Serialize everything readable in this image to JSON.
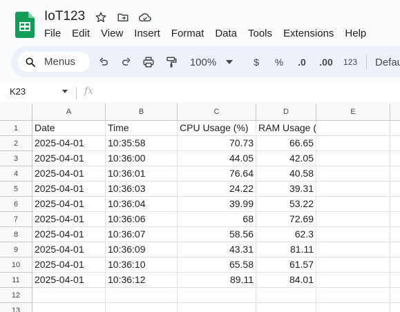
{
  "doc": {
    "title": "IoT123",
    "menus": [
      "File",
      "Edit",
      "View",
      "Insert",
      "Format",
      "Data",
      "Tools",
      "Extensions",
      "Help"
    ]
  },
  "toolbar": {
    "search_label": "Menus",
    "zoom": "100%",
    "currency": "$",
    "percent": "%",
    "dec_decrease": ".0",
    "dec_increase": ".00",
    "number_format": "123",
    "font": "Defau"
  },
  "formula_bar": {
    "cell_ref": "K23",
    "fx_label": "fx"
  },
  "sheet": {
    "columns": [
      "A",
      "B",
      "C",
      "D",
      "E"
    ],
    "row_numbers": [
      "1",
      "2",
      "3",
      "4",
      "5",
      "6",
      "7",
      "8",
      "9",
      "10",
      "11",
      "12",
      "13"
    ],
    "header_row": [
      "Date",
      "Time",
      "CPU Usage (%)",
      "RAM Usage (%)"
    ],
    "rows": [
      [
        "2025-04-01",
        "10:35:58",
        "70.73",
        "66.65"
      ],
      [
        "2025-04-01",
        "10:36:00",
        "44.05",
        "42.05"
      ],
      [
        "2025-04-01",
        "10:36:01",
        "76.64",
        "40.58"
      ],
      [
        "2025-04-01",
        "10:36:03",
        "24.22",
        "39.31"
      ],
      [
        "2025-04-01",
        "10:36:04",
        "39.99",
        "53.22"
      ],
      [
        "2025-04-01",
        "10:36:06",
        "68",
        "72.69"
      ],
      [
        "2025-04-01",
        "10:36:07",
        "58.56",
        "62.3"
      ],
      [
        "2025-04-01",
        "10:36:09",
        "43.31",
        "81.11"
      ],
      [
        "2025-04-01",
        "10:36:10",
        "65.58",
        "61.57"
      ],
      [
        "2025-04-01",
        "10:36:12",
        "89.11",
        "84.01"
      ]
    ]
  },
  "colors": {
    "sheets_green": "#0f9d58",
    "toolbar_bg": "#edf2fa",
    "header_bg": "#f8f9fa"
  }
}
